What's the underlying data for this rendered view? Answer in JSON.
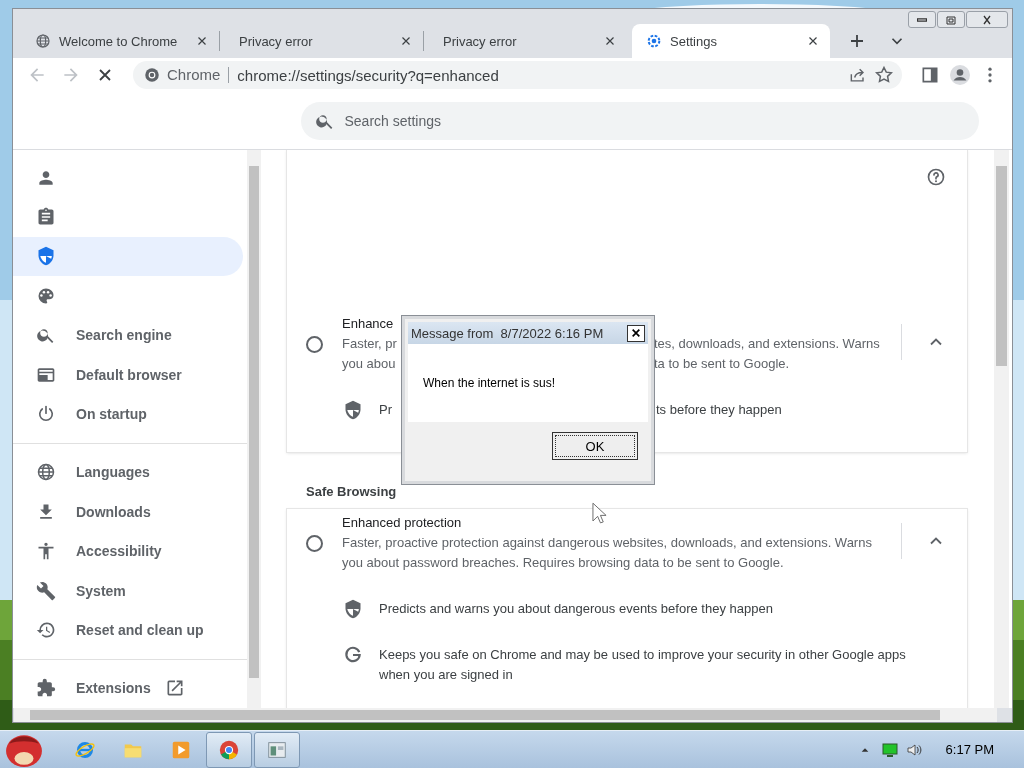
{
  "tabs": [
    {
      "kind": "page",
      "title": "Welcome to Chrome",
      "selected": false
    },
    {
      "kind": "error",
      "title": "Privacy error",
      "selected": false
    },
    {
      "kind": "error",
      "title": "Privacy error",
      "selected": false
    },
    {
      "kind": "settings",
      "title": "Settings",
      "selected": true
    }
  ],
  "toolbar": {
    "nav": [
      {
        "kind": "back",
        "disabled": true
      },
      {
        "kind": "forward",
        "disabled": true
      },
      {
        "kind": "stop",
        "disabled": false
      }
    ],
    "site_label": "Chrome",
    "url": "chrome://settings/security?q=enhanced"
  },
  "search": {
    "placeholder": "Search settings"
  },
  "sidebar": {
    "groups": [
      {
        "items": [
          {
            "kind": "person",
            "selected": false
          },
          {
            "kind": "clipboard",
            "selected": false
          },
          {
            "kind": "shield",
            "selected": true
          },
          {
            "kind": "palette",
            "selected": false
          },
          {
            "kind": "search",
            "label": "Search engine",
            "selected": false
          },
          {
            "kind": "browser",
            "label": "Default browser",
            "selected": false
          },
          {
            "kind": "power",
            "label": "On startup",
            "selected": false
          }
        ]
      },
      {
        "items": [
          {
            "kind": "globe",
            "label": "Languages",
            "selected": false
          },
          {
            "kind": "download",
            "label": "Downloads",
            "selected": false
          },
          {
            "kind": "accessibility",
            "label": "Accessibility",
            "selected": false
          },
          {
            "kind": "wrench",
            "label": "System",
            "selected": false
          },
          {
            "kind": "history",
            "label": "Reset and clean up",
            "selected": false
          }
        ]
      },
      {
        "items": [
          {
            "kind": "puzzle",
            "label": "Extensions",
            "external": true,
            "selected": false
          }
        ]
      }
    ]
  },
  "partial_option": {
    "selected": false,
    "expanded": true,
    "title": "Enhance",
    "description_lines": [
      [
        "Faster, pr",
        "tes, downloads, and extensions. Warns"
      ],
      [
        "you abou",
        "ta to be sent to Google."
      ]
    ],
    "features": [
      {
        "kind": "shield",
        "parts": [
          "Pr",
          "ts before they happen"
        ]
      }
    ]
  },
  "safe_browsing": {
    "heading": "Safe Browsing",
    "option": {
      "selected": false,
      "expanded": true,
      "title": "Enhanced protection",
      "description": "Faster, proactive protection against dangerous websites, downloads, and extensions. Warns you about password breaches. Requires browsing data to be sent to Google.",
      "features": [
        {
          "kind": "shield",
          "text": "Predicts and warns you about dangerous events before they happen"
        },
        {
          "kind": "g",
          "text": "Keeps you safe on Chrome and may be used to improve your security in other Google apps when you are signed in"
        }
      ]
    }
  },
  "dialog": {
    "title": "Message from  8/7/2022 6:16 PM",
    "message": "When the internet is sus!",
    "button": "OK"
  },
  "taskbar": {
    "apps": [
      {
        "kind": "ie",
        "active": false
      },
      {
        "kind": "folder",
        "active": false
      },
      {
        "kind": "media",
        "active": false
      },
      {
        "kind": "chrome",
        "active": true
      },
      {
        "kind": "window",
        "active": true
      }
    ],
    "clock": "6:17 PM"
  }
}
